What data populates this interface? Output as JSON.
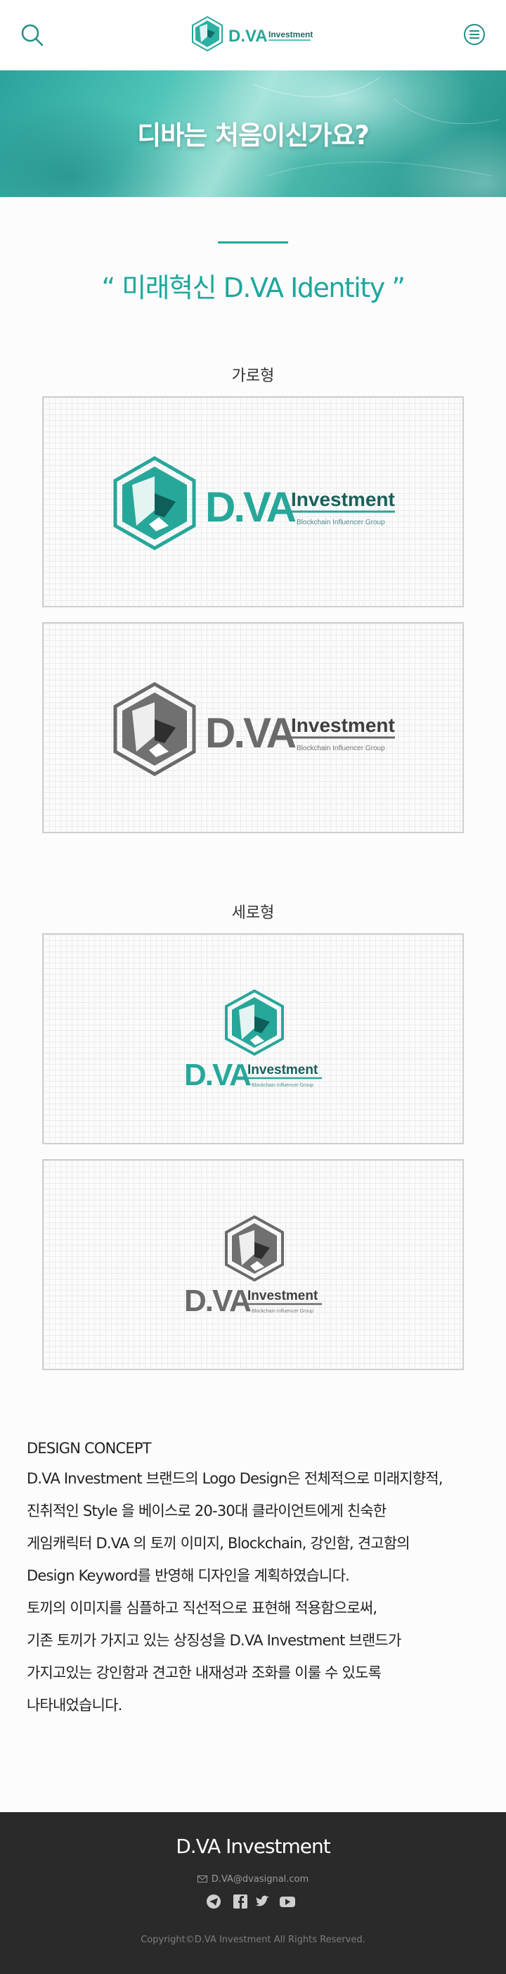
{
  "header": {
    "logo_brand_text": "D.VA",
    "logo_word_text": "Investment",
    "icons": {
      "search": "search-icon",
      "menu": "menu-icon"
    }
  },
  "hero": {
    "title": "디바는 처음이신가요?"
  },
  "identity": {
    "heading": "“ 미래혁신 D.VA Identity ”",
    "horizontal_label": "가로형",
    "vertical_label": "세로형",
    "logo_tagline": "Blockchain Influencer Group",
    "colors": {
      "accent": "#1ea79c",
      "logo_teal": "#27a79a",
      "logo_gray": "#6a6a6a"
    }
  },
  "design_concept": {
    "title": "DESIGN CONCEPT",
    "lines": [
      "D.VA Investment 브랜드의 Logo Design은 전체적으로 미래지향적,",
      "진취적인 Style 을 베이스로 20-30대 클라이언트에게 친숙한",
      "게임캐릭터 D.VA 의 토끼 이미지, Blockchain, 강인함, 견고함의",
      "Design Keyword를 반영해 디자인을 계획하였습니다.",
      "토끼의 이미지를 심플하고 직선적으로 표현해 적용함으로써,",
      "기존 토끼가 가지고 있는 상징성을 D.VA Investment 브랜드가",
      "가지고있는 강인함과 견고한 내재성과 조화를 이룰 수 있도록",
      "나타내었습니다."
    ]
  },
  "footer": {
    "brand": "D.VA Investment",
    "email": "D.VA@dvasignal.com",
    "social_icons": [
      "telegram-icon",
      "facebook-icon",
      "twitter-icon",
      "youtube-icon"
    ],
    "copyright": "Copyright©D.VA Investment All Rights Reserved."
  }
}
